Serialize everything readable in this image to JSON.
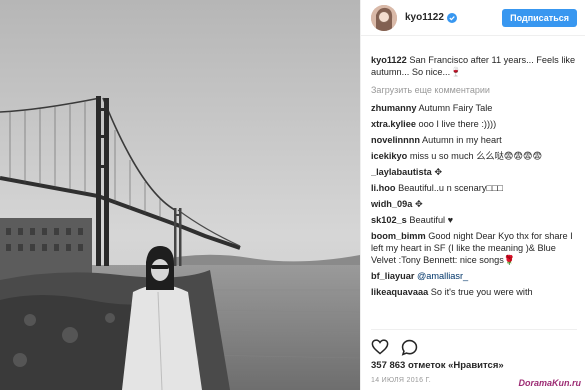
{
  "header": {
    "username": "kyo1122",
    "follow_label": "Подписаться"
  },
  "caption": {
    "username": "kyo1122",
    "text": "San Francisco after 11 years... Feels like autumn... So nice...🍷"
  },
  "load_more_label": "Загрузить еще комментарии",
  "comments": [
    {
      "username": "zhumanny",
      "text": "Autumn Fairy Tale"
    },
    {
      "username": "xtra.kyliee",
      "text": "ooo I live there :))))"
    },
    {
      "username": "novelinnnn",
      "text": "Autumn in my heart"
    },
    {
      "username": "icekikyo",
      "text": "miss u so much 么么哒😨😨😨😨"
    },
    {
      "username": "_laylabautista",
      "text": "✥"
    },
    {
      "username": "li.hoo",
      "text": "Beautiful..u n scenary□□□"
    },
    {
      "username": "widh_09a",
      "text": "✥"
    },
    {
      "username": "sk102_s",
      "text": "Beautiful ♥"
    },
    {
      "username": "boom_bimm",
      "text": "Good night Dear Kyo thx for share I left my heart in SF (I like the meaning )& Blue Velvet :Tony Bennett: nice songs🌹"
    },
    {
      "username": "bf_liayuar",
      "text": "",
      "mention": "@amalliasr_"
    },
    {
      "username": "likeaquavaaa",
      "text": "So it's true you were with"
    }
  ],
  "likes_text": "357 863 отметок «Нравится»",
  "date_text": "14 ИЮЛЯ 2016 Г.",
  "watermark": "DoramaKun.ru",
  "icons": {
    "verified": "verified-badge-icon",
    "like": "heart-icon",
    "comment": "comment-bubble-icon"
  },
  "colors": {
    "follow_button": "#3897f0",
    "verified": "#3897f0",
    "mention": "#003569",
    "muted": "#999999"
  }
}
